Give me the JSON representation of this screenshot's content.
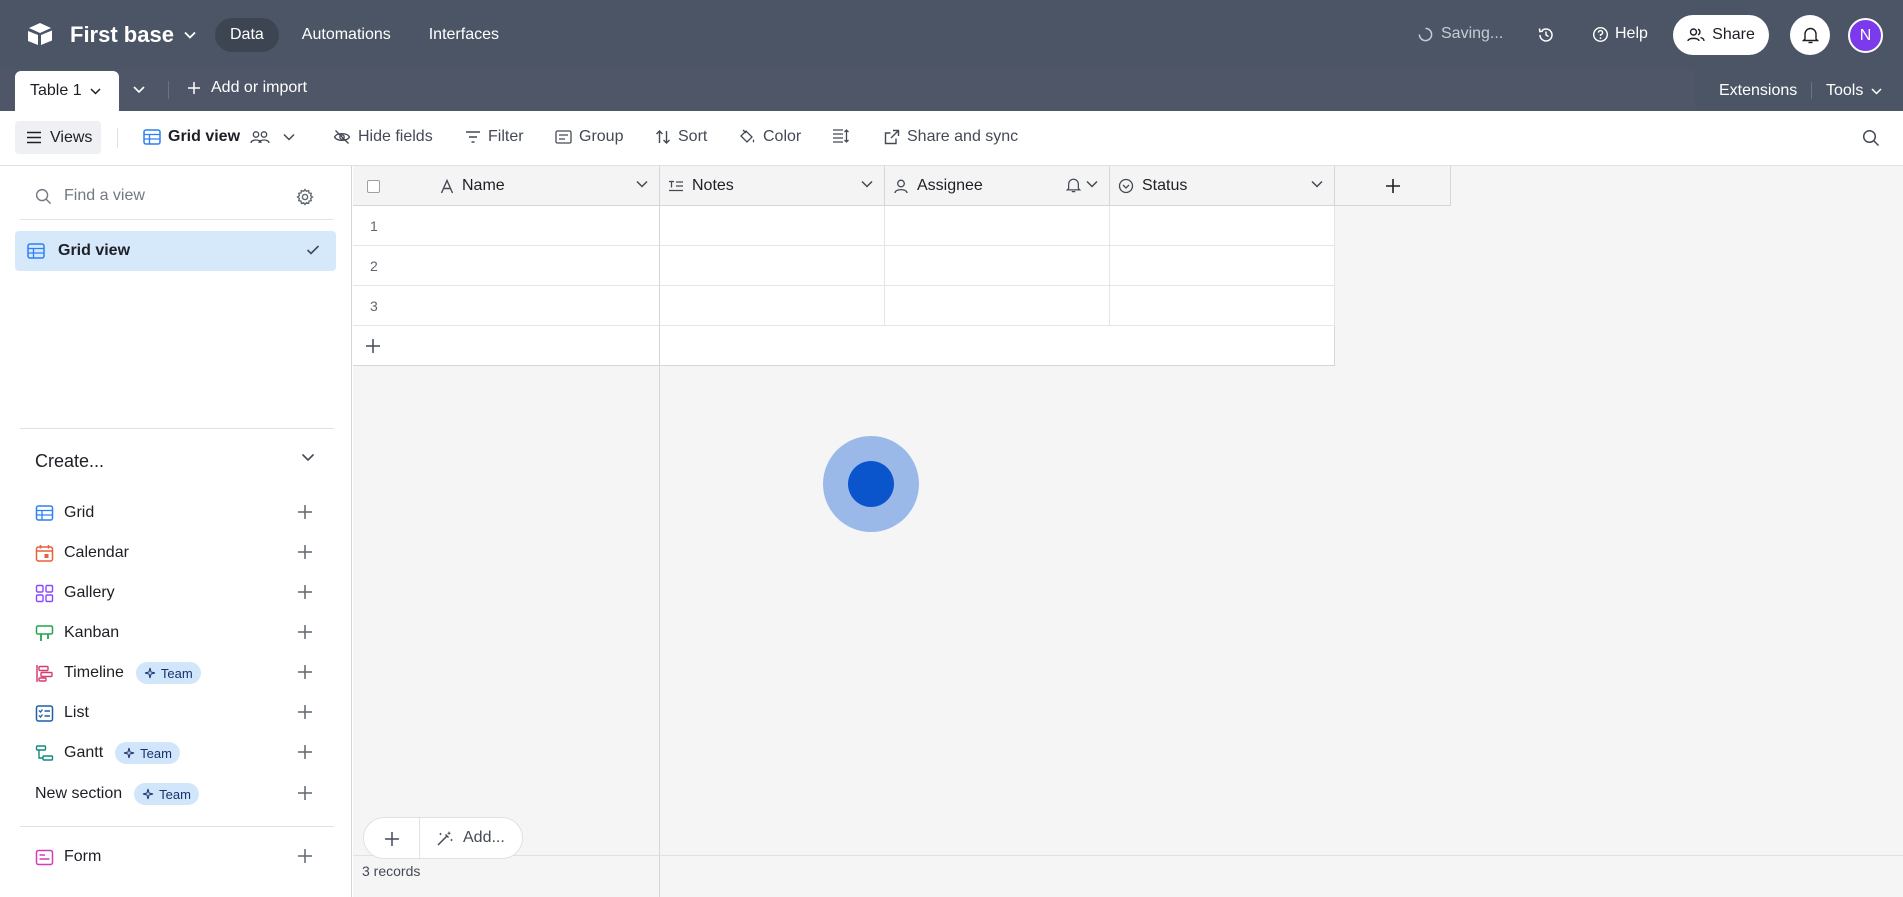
{
  "app": {
    "base_name": "First base",
    "nav": [
      "Data",
      "Automations",
      "Interfaces"
    ],
    "saving": "Saving...",
    "help": "Help",
    "share": "Share",
    "avatar_initial": "N",
    "avatar_color": "#7c3aed",
    "topbar_color": "#4c5566"
  },
  "tabs": {
    "active_table": "Table 1",
    "add_or_import": "Add or import",
    "extensions": "Extensions",
    "tools": "Tools"
  },
  "toolbar": {
    "views": "Views",
    "grid_view": "Grid view",
    "hide_fields": "Hide fields",
    "filter": "Filter",
    "group": "Group",
    "sort": "Sort",
    "color": "Color",
    "share_and_sync": "Share and sync"
  },
  "sidebar": {
    "find_placeholder": "Find a view",
    "current_view": "Grid view",
    "create_heading": "Create...",
    "team_badge": "Team",
    "create_items": [
      {
        "label": "Grid",
        "icon": "grid-icon",
        "color": "#2d7ff9",
        "badge": ""
      },
      {
        "label": "Calendar",
        "icon": "calendar-icon",
        "color": "#e8603c",
        "badge": ""
      },
      {
        "label": "Gallery",
        "icon": "gallery-icon",
        "color": "#8b46ff",
        "badge": ""
      },
      {
        "label": "Kanban",
        "icon": "kanban-icon",
        "color": "#20a64c",
        "badge": ""
      },
      {
        "label": "Timeline",
        "icon": "timeline-icon",
        "color": "#d63c6e",
        "badge": "Team"
      },
      {
        "label": "List",
        "icon": "list-icon",
        "color": "#1f5fa8",
        "badge": ""
      },
      {
        "label": "Gantt",
        "icon": "gantt-icon",
        "color": "#0f8a7e",
        "badge": "Team"
      },
      {
        "label": "New section",
        "icon": "",
        "color": "",
        "badge": "Team"
      }
    ],
    "form": {
      "label": "Form",
      "icon": "form-icon",
      "color": "#d63cb8"
    }
  },
  "grid": {
    "columns": [
      {
        "label": "Name",
        "icon": "text-field-icon"
      },
      {
        "label": "Notes",
        "icon": "long-text-icon"
      },
      {
        "label": "Assignee",
        "icon": "user-icon"
      },
      {
        "label": "Status",
        "icon": "status-icon"
      }
    ],
    "rows": [
      "1",
      "2",
      "3"
    ],
    "records": "3 records",
    "add_label": "Add..."
  }
}
